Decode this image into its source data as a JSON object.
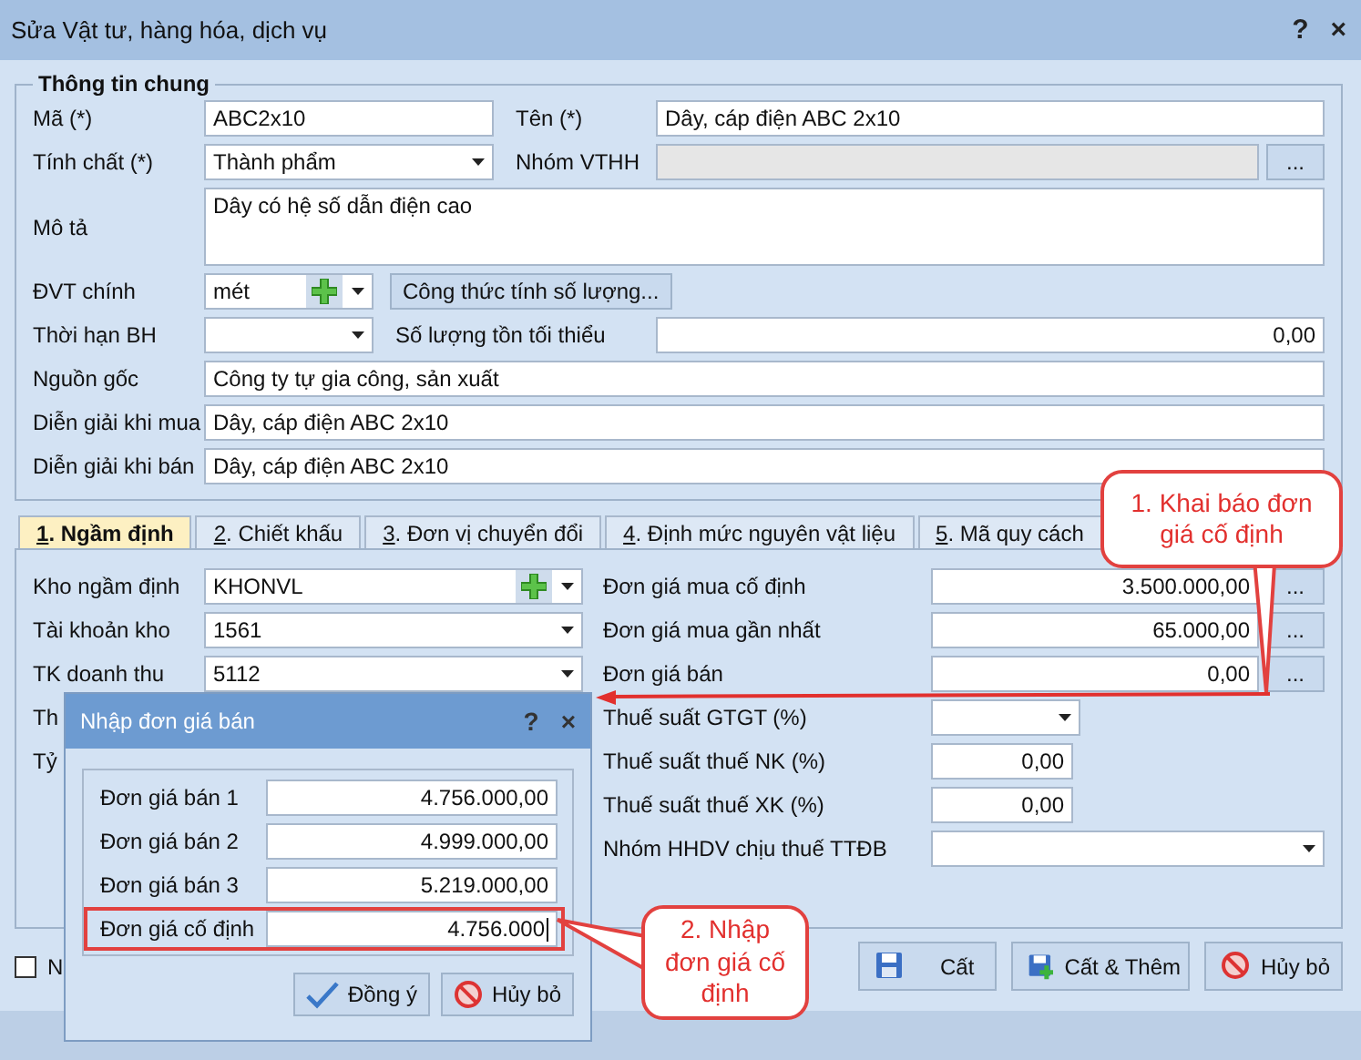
{
  "window": {
    "title": "Sửa Vật tư, hàng hóa, dịch vụ",
    "help": "?",
    "close": "×"
  },
  "general": {
    "title": "Thông tin chung",
    "code": {
      "label": "Mã (*)",
      "value": "ABC2x10"
    },
    "name": {
      "label": "Tên (*)",
      "value": "Dây, cáp điện ABC 2x10"
    },
    "nature": {
      "label": "Tính chất (*)",
      "value": "Thành phẩm"
    },
    "group": {
      "label": "Nhóm VTHH",
      "disabled": true,
      "button": "..."
    },
    "description": {
      "label": "Mô tả",
      "value": "Dây có hệ số dẫn điện cao"
    },
    "unit": {
      "label": "ĐVT chính",
      "value": "mét"
    },
    "formula_button": "Công thức tính số lượng...",
    "warranty": {
      "label": "Thời hạn BH"
    },
    "min_stock": {
      "label": "Số lượng tồn tối thiểu",
      "value": "0,00"
    },
    "origin": {
      "label": "Nguồn gốc",
      "value": "Công ty tự gia công, sản xuất"
    },
    "purchase_desc": {
      "label": "Diễn giải khi mua",
      "value": "Dây, cáp điện ABC 2x10"
    },
    "sale_desc": {
      "label": "Diễn giải khi bán",
      "value": "Dây, cáp điện ABC 2x10"
    }
  },
  "tabs": [
    {
      "key": "1",
      "label": ". Ngầm định",
      "selected": true
    },
    {
      "key": "2",
      "label": ". Chiết khấu",
      "selected": false
    },
    {
      "key": "3",
      "label": ". Đơn vị chuyển đổi",
      "selected": false
    },
    {
      "key": "4",
      "label": ". Định mức nguyên vật liệu",
      "selected": false
    },
    {
      "key": "5",
      "label": ". Mã quy cách",
      "selected": false
    }
  ],
  "defaults_left": [
    {
      "kind": "combo-add",
      "label": "Kho ngầm định",
      "value": "KHONVL"
    },
    {
      "kind": "combo",
      "label": "Tài khoản kho",
      "value": "1561"
    },
    {
      "kind": "combo",
      "label": "TK doanh thu",
      "value": "5112"
    },
    {
      "kind": "label",
      "label": "Th"
    },
    {
      "kind": "label",
      "label": "Tỷ"
    }
  ],
  "defaults_right": [
    {
      "kind": "browse",
      "label": "Đơn giá mua cố định",
      "value": "3.500.000,00",
      "button": "..."
    },
    {
      "kind": "browse",
      "label": "Đơn giá mua gần nhất",
      "value": "65.000,00",
      "button": "..."
    },
    {
      "kind": "browse",
      "label": "Đơn giá bán",
      "value": "0,00",
      "button": "..."
    },
    {
      "kind": "combo-short",
      "label": "Thuế suất GTGT (%)"
    },
    {
      "kind": "short",
      "label": "Thuế suất thuế NK (%)",
      "value": "0,00"
    },
    {
      "kind": "short",
      "label": "Thuế suất thuế XK (%)",
      "value": "0,00"
    },
    {
      "kind": "combo-wide",
      "label": "Nhóm HHDV chịu thuế TTĐB"
    }
  ],
  "checkbox": {
    "label": "N",
    "checked": false
  },
  "buttons": [
    {
      "kind": "save",
      "label": "Cất"
    },
    {
      "kind": "save-new",
      "label": "Cất & Thêm"
    },
    {
      "kind": "cancel",
      "label": "Hủy bỏ"
    }
  ],
  "popup": {
    "title": "Nhập đơn giá bán",
    "help": "?",
    "close": "×",
    "rows": [
      {
        "label": "Đơn giá bán 1",
        "value": "4.756.000,00",
        "highlighted": false,
        "focused": false
      },
      {
        "label": "Đơn giá bán 2",
        "value": "4.999.000,00",
        "highlighted": false,
        "focused": false
      },
      {
        "label": "Đơn giá bán 3",
        "value": "5.219.000,00",
        "highlighted": false,
        "focused": false
      },
      {
        "label": "Đơn giá cố định",
        "value": "4.756.000",
        "highlighted": true,
        "focused": true
      }
    ],
    "buttons": [
      {
        "kind": "ok",
        "label": "Đồng ý"
      },
      {
        "kind": "cancel",
        "label": "Hủy bỏ"
      }
    ]
  },
  "callouts": [
    {
      "text": "1. Khai báo đơn giá cố định"
    },
    {
      "text": "2. Nhập đơn giá cố định"
    }
  ]
}
